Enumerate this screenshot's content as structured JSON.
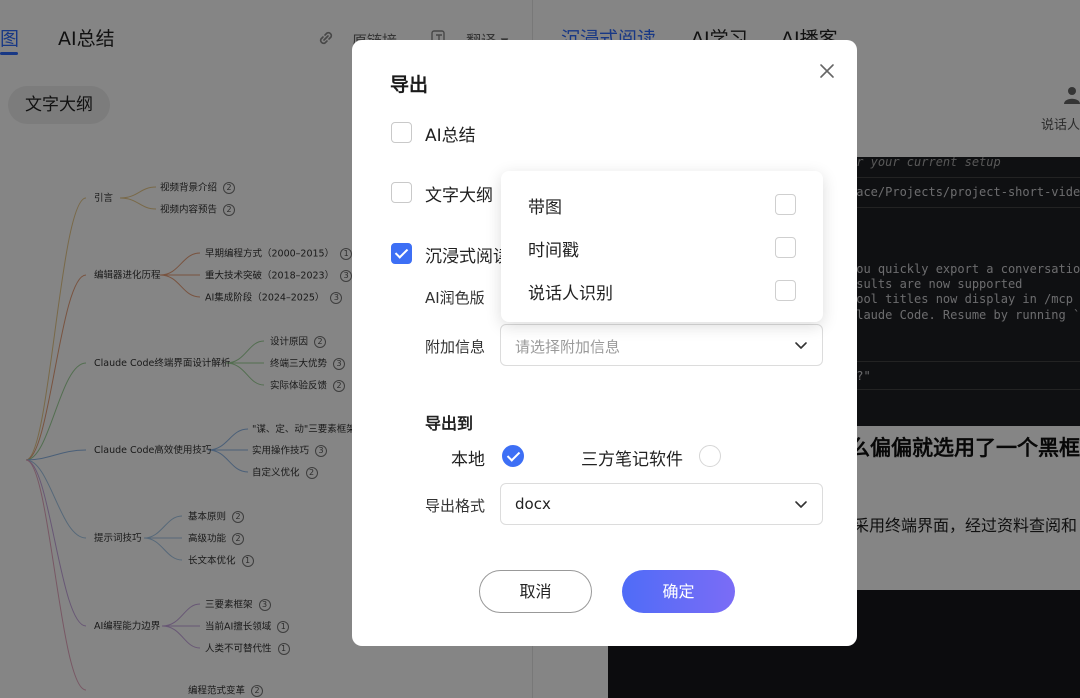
{
  "left_tabs": {
    "mindmap_partial": "图",
    "ai_summary": "AI总结"
  },
  "left_toolbar": {
    "link_icon": "link-icon",
    "original_link": "原链接",
    "translate_icon": "translate-icon",
    "translate": "翻译 ▾"
  },
  "outline_chip": "文字大纲",
  "mindmap": {
    "nodes": [
      {
        "label": "引言",
        "children": [
          {
            "label": "视频背景介绍",
            "badge": "2"
          },
          {
            "label": "视频内容预告",
            "badge": "2"
          }
        ]
      },
      {
        "label": "编辑器进化历程",
        "children": [
          {
            "label": "早期编程方式（2000–2015）",
            "badge": "1"
          },
          {
            "label": "重大技术突破（2018–2023）",
            "badge": "3"
          },
          {
            "label": "AI集成阶段（2024–2025）",
            "badge": "3"
          }
        ]
      },
      {
        "label": "Claude Code终端界面设计解析",
        "children": [
          {
            "label": "设计原因",
            "badge": "2"
          },
          {
            "label": "终端三大优势",
            "badge": "3"
          },
          {
            "label": "实际体验反馈",
            "badge": "2"
          }
        ]
      },
      {
        "label": "Claude Code高效使用技巧",
        "children": [
          {
            "label": "\"谋、定、动\"三要素框架",
            "badge": ""
          },
          {
            "label": "实用操作技巧",
            "badge": "3"
          },
          {
            "label": "自定义优化",
            "badge": "2"
          }
        ]
      },
      {
        "label": "提示词技巧",
        "children": [
          {
            "label": "基本原则",
            "badge": "2"
          },
          {
            "label": "高级功能",
            "badge": "2"
          },
          {
            "label": "长文本优化",
            "badge": "1"
          }
        ]
      },
      {
        "label": "AI编程能力边界",
        "children": [
          {
            "label": "三要素框架",
            "badge": "3"
          },
          {
            "label": "当前AI擅长领域",
            "badge": "1"
          },
          {
            "label": "人类不可替代性",
            "badge": "1"
          }
        ]
      },
      {
        "label": "",
        "children": [
          {
            "label": "编程范式变革",
            "badge": "2"
          }
        ]
      }
    ]
  },
  "right_tabs": {
    "immersive": "沉浸式阅读",
    "ai_learn": "AI学习",
    "ai_podcast": "AI播客"
  },
  "speaker": {
    "icon": "person-icon",
    "label": "说话人"
  },
  "terminal_lines": [
    "or your current setup",
    "pace/Projects/project-short-video",
    "you quickly export a conversation",
    "esults are now supported",
    " tool titles now display in /mcp",
    " Claude Code. Resume by running `",
    "k?\""
  ],
  "subtitle_fragment": "么偏偏就选用了一个黑框",
  "body_fragment": "采用终端界面，经过资料查阅和",
  "modal": {
    "title": "导出",
    "close_icon": "close-icon",
    "options": [
      {
        "label": "AI总结",
        "checked": false
      },
      {
        "label": "文字大纲",
        "checked": false
      },
      {
        "label": "沉浸式阅读",
        "checked": true
      }
    ],
    "polish_label": "AI润色版",
    "extra_info": {
      "label": "附加信息",
      "placeholder": "请选择附加信息"
    },
    "export_to": {
      "label": "导出到",
      "local": "本地",
      "local_checked": true,
      "third_party": "三方笔记软件",
      "third_party_checked": false
    },
    "format": {
      "label": "导出格式",
      "value": "docx"
    },
    "cancel": "取消",
    "confirm": "确定"
  },
  "dropdown": {
    "items": [
      {
        "label": "带图",
        "checked": false
      },
      {
        "label": "时间戳",
        "checked": false
      },
      {
        "label": "说话人识别",
        "checked": false
      }
    ]
  },
  "colors": {
    "accent": "#3d6ff5",
    "button_gradient_start": "#4f6cf7",
    "button_gradient_end": "#7b6cf6",
    "overlay": "rgba(0,0,0,0.48)"
  }
}
